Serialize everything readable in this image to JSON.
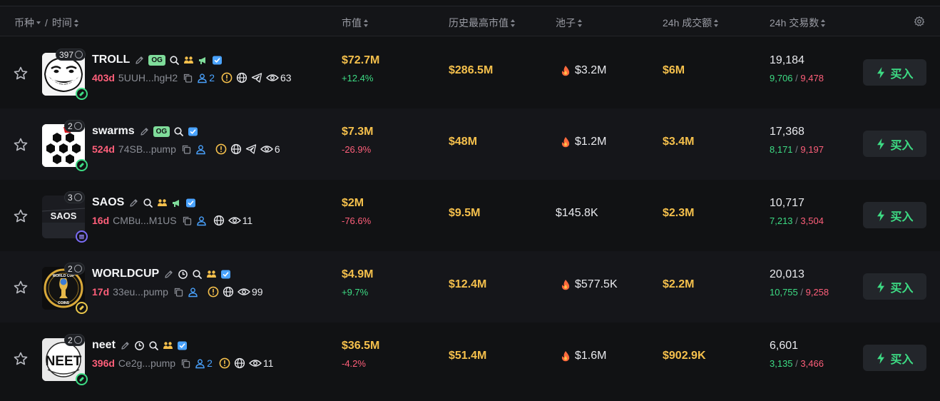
{
  "header": {
    "coin_label": "币种",
    "slash": "/",
    "time_label": "时间",
    "mcap_label": "市值",
    "ath_label": "历史最高市值",
    "pool_label": "池子",
    "volume_label": "24h 成交额",
    "txns_label": "24h 交易数"
  },
  "buy_label": "买入",
  "colors": {
    "accent_green": "#3ddc84",
    "accent_red": "#ff5f7a",
    "value_gold": "#f5c04c",
    "link_blue": "#4aa3ff"
  },
  "tokens": [
    {
      "name": "TROLL",
      "holders": "397",
      "og": "OG",
      "age": "403d",
      "address": "5UUH...hgH2",
      "dev_count": "2",
      "views": "63",
      "mcap": "$72.7M",
      "change": "+12.4%",
      "ath": "$286.5M",
      "pool": "$3.2M",
      "volume": "$6M",
      "txns": "19,184",
      "buys": "9,706",
      "sells": "9,478",
      "chain": "pump-pill-icon"
    },
    {
      "name": "swarms",
      "holders": "2",
      "og": "OG",
      "age": "524d",
      "address": "74SB...pump",
      "dev_count": "",
      "views": "6",
      "mcap": "$7.3M",
      "change": "-26.9%",
      "ath": "$48M",
      "pool": "$1.2M",
      "volume": "$3.4M",
      "txns": "17,368",
      "buys": "8,171",
      "sells": "9,197",
      "chain": "pump-pill-icon"
    },
    {
      "name": "SAOS",
      "holders": "3",
      "age": "16d",
      "address": "CMBu...M1US",
      "avatar_text": "SAOS",
      "views": "11",
      "mcap": "$2M",
      "change": "-76.6%",
      "ath": "$9.5M",
      "pool": "$145.8K",
      "volume": "$2.3M",
      "txns": "10,717",
      "buys": "7,213",
      "sells": "3,504",
      "chain": "solana-icon"
    },
    {
      "name": "WORLDCUP",
      "holders": "2",
      "age": "17d",
      "address": "33eu...pump",
      "avatar_text_top": "WORLD CUP",
      "avatar_text_bottom": "COINS",
      "views": "99",
      "mcap": "$4.9M",
      "change": "+9.7%",
      "ath": "$12.4M",
      "pool": "$577.5K",
      "volume": "$2.2M",
      "txns": "20,013",
      "buys": "10,755",
      "sells": "9,258",
      "chain": "bonk-icon"
    },
    {
      "name": "neet",
      "holders": "2",
      "age": "396d",
      "address": "Ce2g...pump",
      "avatar_text": "NEET",
      "dev_count": "2",
      "views": "11",
      "mcap": "$36.5M",
      "change": "-4.2%",
      "ath": "$51.4M",
      "pool": "$1.6M",
      "volume": "$902.9K",
      "txns": "6,601",
      "buys": "3,135",
      "sells": "3,466",
      "chain": "pump-pill-icon"
    }
  ]
}
